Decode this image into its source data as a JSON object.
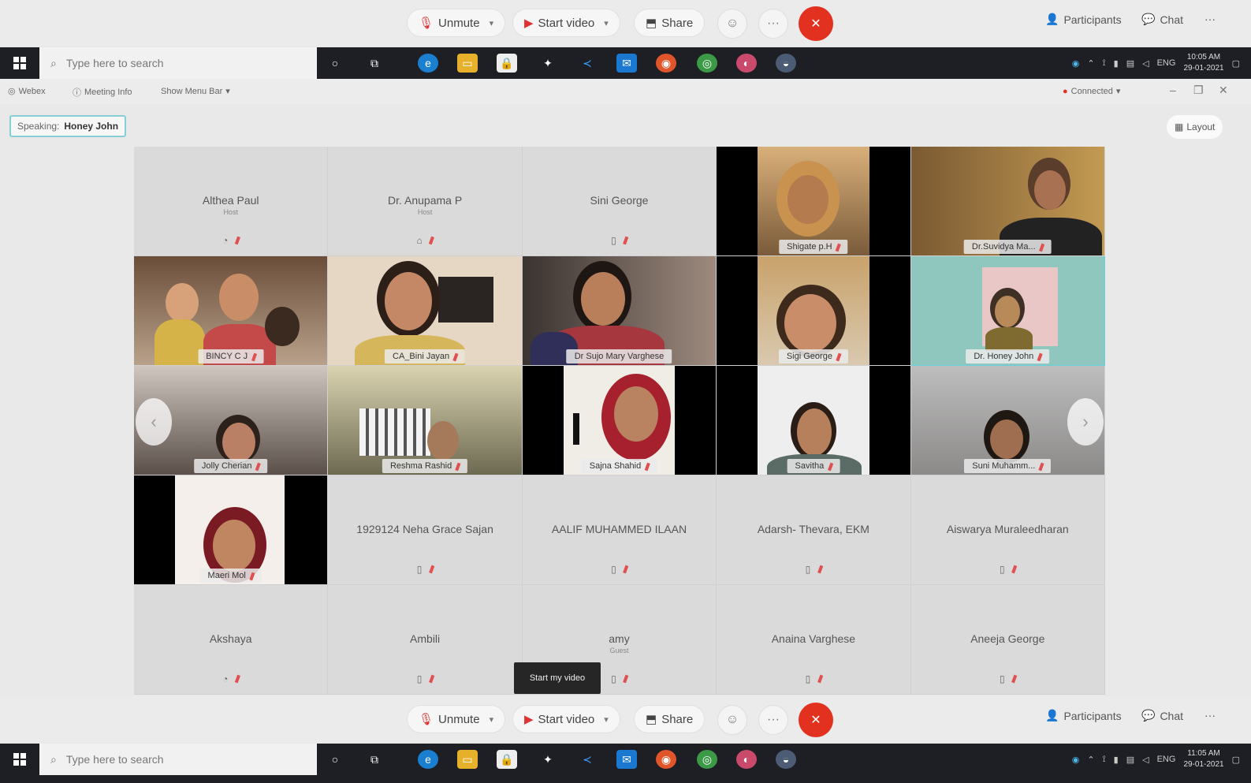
{
  "controls": {
    "unmute": "Unmute",
    "start_video": "Start video",
    "share": "Share",
    "participants": "Participants",
    "chat": "Chat"
  },
  "taskbar": {
    "search_placeholder": "Type here to search",
    "language": "ENG",
    "time_top": "10:05 AM",
    "date_top": "29-01-2021",
    "time_bottom": "11:05 AM",
    "date_bottom": "29-01-2021"
  },
  "menubar": {
    "webex": "Webex",
    "meeting_info": "Meeting Info",
    "show_menu_bar": "Show Menu Bar",
    "connected": "Connected"
  },
  "speaking": {
    "label": "Speaking:",
    "name": "Honey John"
  },
  "layout_label": "Layout",
  "tooltip": "Start my video",
  "participants": [
    {
      "name": "Althea Paul",
      "sub": "Host"
    },
    {
      "name": "Dr. Anupama P",
      "sub": "Host"
    },
    {
      "name": "Sini George",
      "sub": ""
    },
    {
      "name": "Shigate p.H",
      "sub": ""
    },
    {
      "name": "Dr.Suvidya Ma...",
      "sub": ""
    },
    {
      "name": "BINCY C J",
      "sub": ""
    },
    {
      "name": "CA_Bini Jayan",
      "sub": ""
    },
    {
      "name": "Dr Sujo Mary Varghese",
      "sub": ""
    },
    {
      "name": "Sigi George",
      "sub": ""
    },
    {
      "name": "Dr. Honey John",
      "sub": ""
    },
    {
      "name": "Jolly Cherian",
      "sub": ""
    },
    {
      "name": "Reshma Rashid",
      "sub": ""
    },
    {
      "name": "Sajna Shahid",
      "sub": ""
    },
    {
      "name": "Savitha",
      "sub": ""
    },
    {
      "name": "Suni Muhamm...",
      "sub": ""
    },
    {
      "name": "Maeri Mol",
      "sub": ""
    },
    {
      "name": "1929124 Neha Grace Sajan",
      "sub": ""
    },
    {
      "name": "AALIF MUHAMMED ILAAN",
      "sub": ""
    },
    {
      "name": "Adarsh- Thevara, EKM",
      "sub": ""
    },
    {
      "name": "Aiswarya Muraleedharan",
      "sub": ""
    },
    {
      "name": "Akshaya",
      "sub": ""
    },
    {
      "name": "Ambili",
      "sub": ""
    },
    {
      "name": "amy",
      "sub": "Guest"
    },
    {
      "name": "Anaina Varghese",
      "sub": ""
    },
    {
      "name": "Aneeja George",
      "sub": ""
    }
  ],
  "colors": {
    "end_button": "#e2321f",
    "active_speaker_border": "#6ad0e0",
    "taskbar_bg": "#1d1f24"
  }
}
